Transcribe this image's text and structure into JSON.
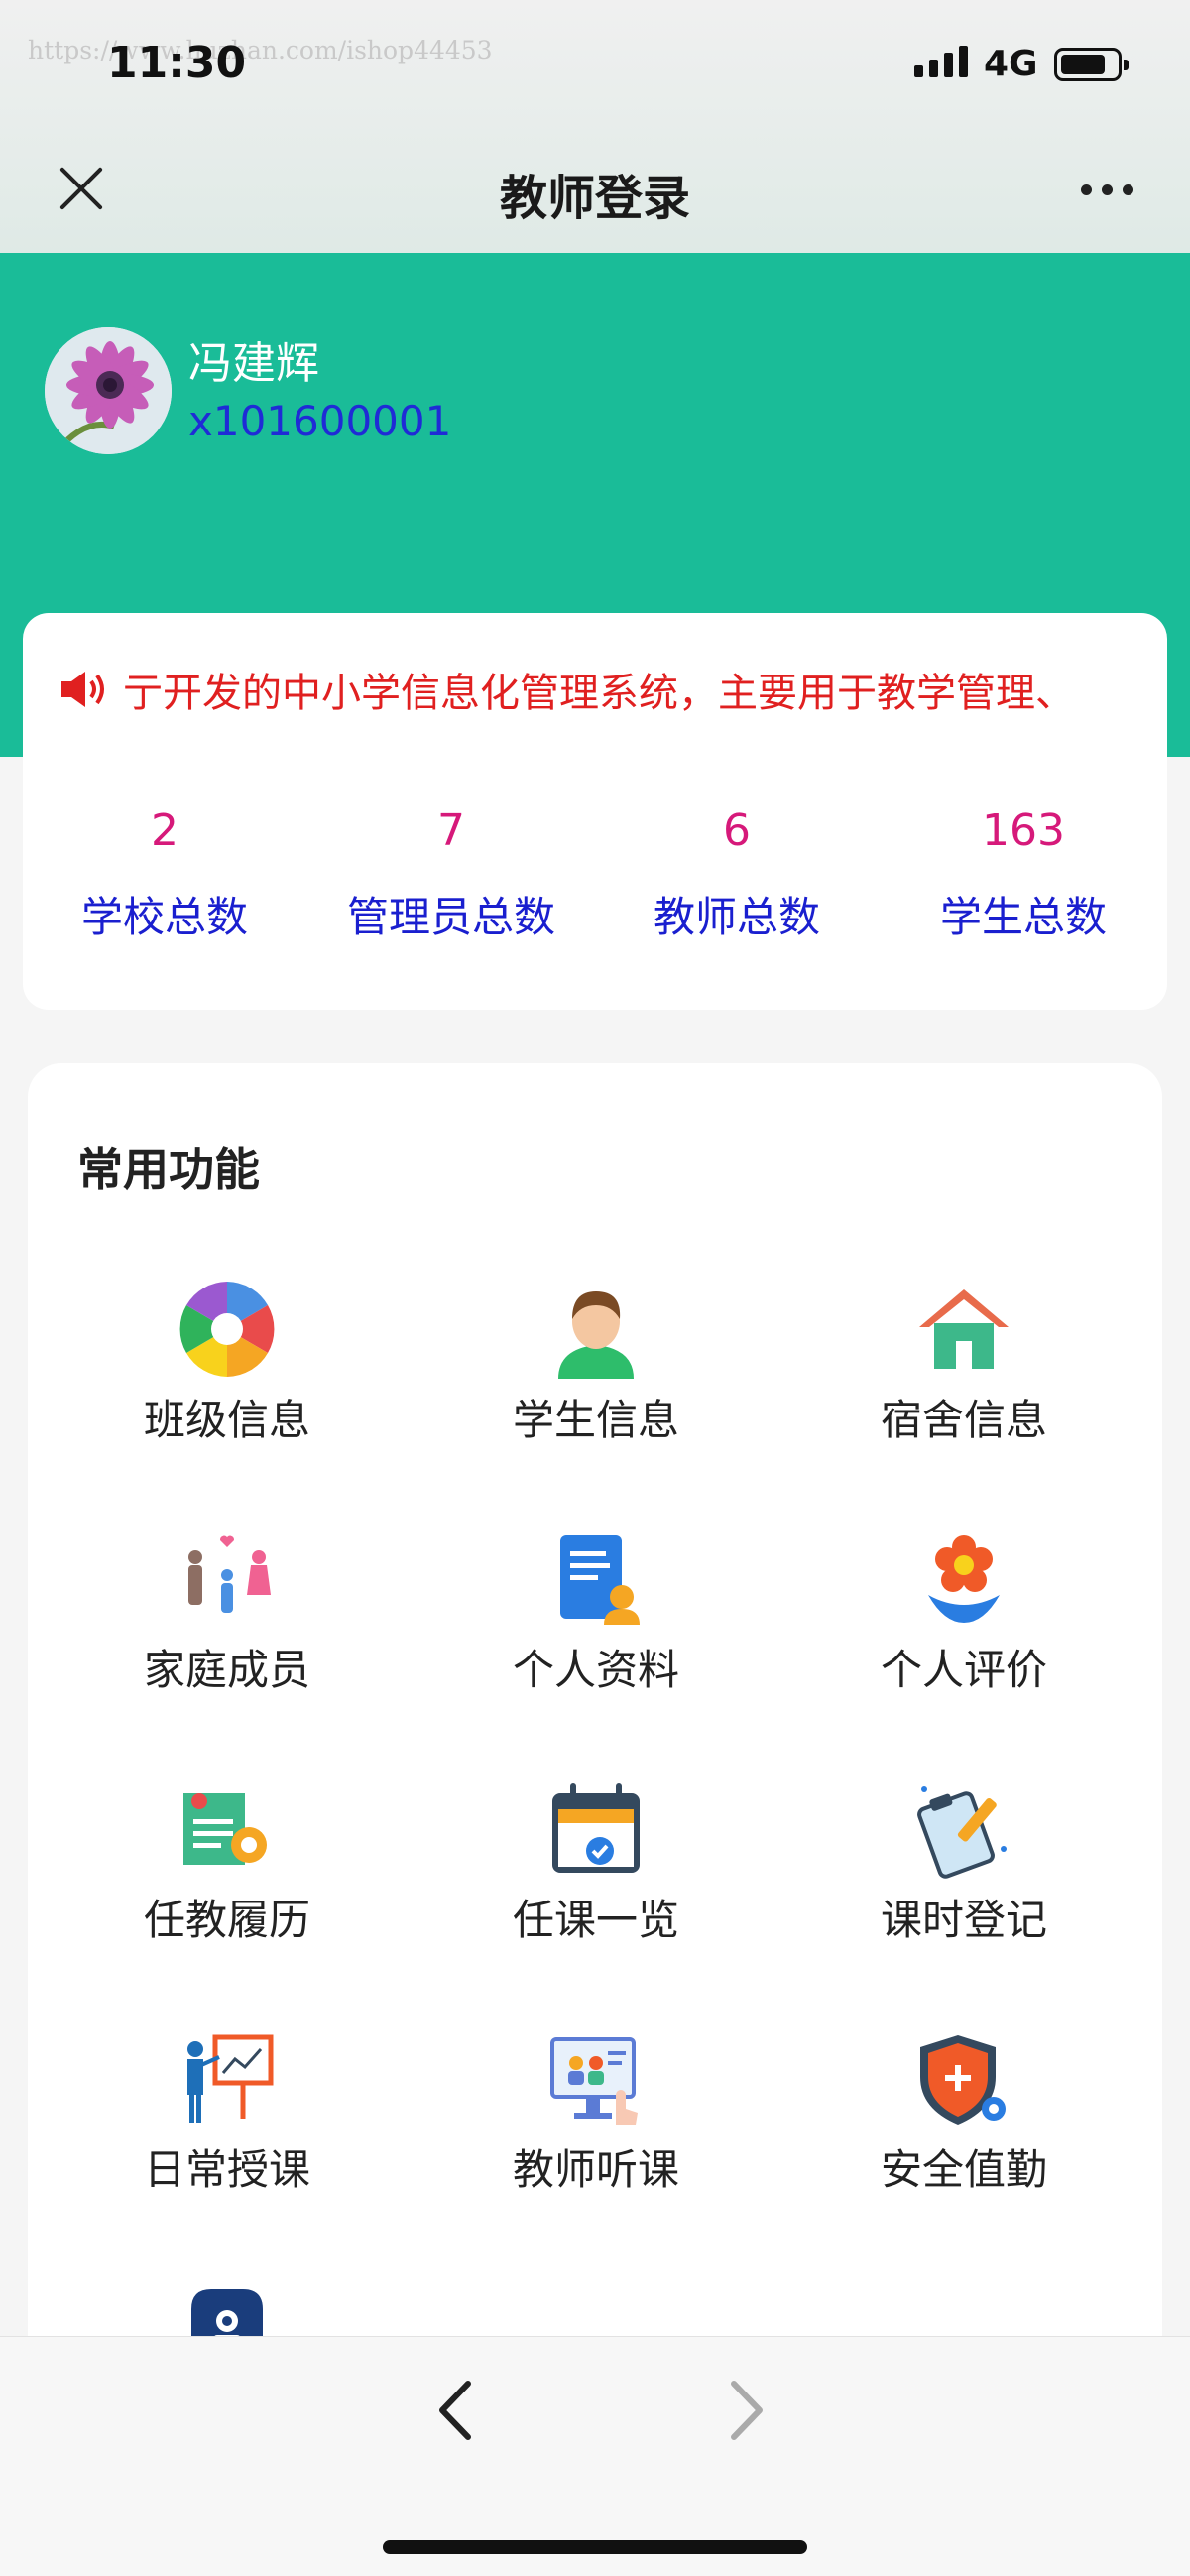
{
  "status_bar": {
    "time": "11:30",
    "network": "4G",
    "watermark": "https://www.huzhan.com/ishop44453"
  },
  "nav": {
    "title": "教师登录"
  },
  "user": {
    "name": "冯建辉",
    "id": "x101600001"
  },
  "notice": {
    "text": "亍开发的中小学信息化管理系统，主要用于教学管理、"
  },
  "stats": [
    {
      "value": "2",
      "label": "学校总数"
    },
    {
      "value": "7",
      "label": "管理员总数"
    },
    {
      "value": "6",
      "label": "教师总数"
    },
    {
      "value": "163",
      "label": "学生总数"
    }
  ],
  "functions": {
    "title": "常用功能",
    "items": [
      {
        "label": "班级信息",
        "icon": "aperture-icon"
      },
      {
        "label": "学生信息",
        "icon": "student-avatar-icon"
      },
      {
        "label": "宿舍信息",
        "icon": "house-icon"
      },
      {
        "label": "家庭成员",
        "icon": "family-icon"
      },
      {
        "label": "个人资料",
        "icon": "profile-document-icon"
      },
      {
        "label": "个人评价",
        "icon": "flower-icon"
      },
      {
        "label": "任教履历",
        "icon": "certificate-gear-icon"
      },
      {
        "label": "任课一览",
        "icon": "calendar-check-icon"
      },
      {
        "label": "课时登记",
        "icon": "clipboard-pencil-icon"
      },
      {
        "label": "日常授课",
        "icon": "lecturer-board-icon"
      },
      {
        "label": "教师听课",
        "icon": "monitor-meeting-icon"
      },
      {
        "label": "安全值勤",
        "icon": "shield-plus-icon"
      }
    ]
  },
  "colors": {
    "header_green": "#1abc98",
    "stat_value": "#d6197a",
    "stat_label": "#1a1fcf",
    "notice": "#e02020"
  }
}
